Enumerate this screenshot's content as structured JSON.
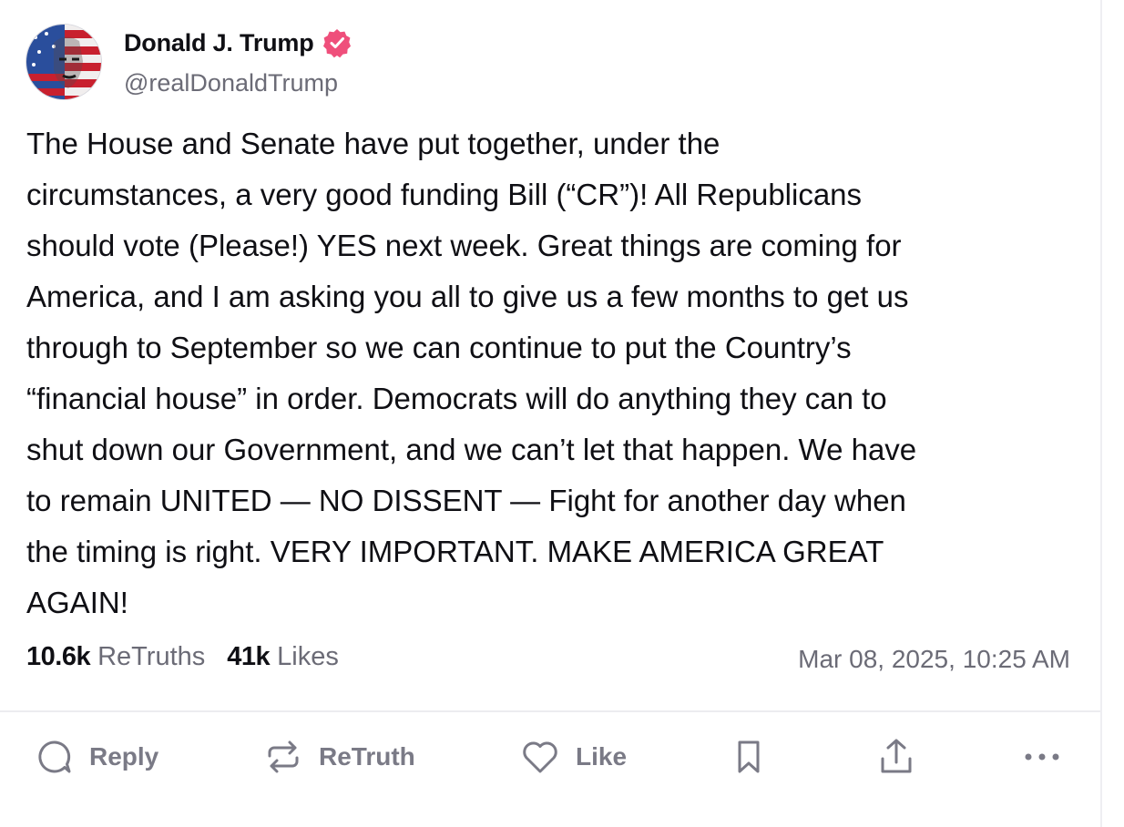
{
  "author": {
    "display_name": "Donald J. Trump",
    "handle": "@realDonaldTrump",
    "verified": true,
    "verified_color": "#ef4f7b"
  },
  "post": {
    "lines": [
      "The House and Senate have put together, under the",
      "circumstances, a very good funding Bill (“CR”)! All Republicans",
      "should vote (Please!) YES next week. Great things are coming for",
      "America, and I am asking you all to give us a few months to get us",
      "through to September so we can continue to put the Country’s",
      "“financial house” in order. Democrats will do anything they can to",
      "shut down our Government, and we can’t let that happen. We have",
      "to remain UNITED — NO DISSENT — Fight for another day when",
      "the timing is right. VERY IMPORTANT. MAKE AMERICA GREAT",
      "AGAIN!"
    ]
  },
  "stats": {
    "retruths_count": "10.6k",
    "retruths_label": "ReTruths",
    "likes_count": "41k",
    "likes_label": "Likes"
  },
  "timestamp": "Mar 08, 2025, 10:25 AM",
  "actions": {
    "reply_label": "Reply",
    "retruth_label": "ReTruth",
    "like_label": "Like",
    "icons": [
      "reply-icon",
      "retruth-icon",
      "like-icon",
      "bookmark-icon",
      "share-icon",
      "more-icon"
    ]
  },
  "colors": {
    "text": "#0f0f14",
    "muted": "#6b6b76",
    "action": "#7a7a86",
    "divider": "#ececf0"
  }
}
